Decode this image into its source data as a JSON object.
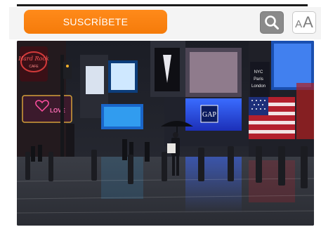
{
  "toolbar": {
    "subscribe_label": "SUSCRÍBETE",
    "search_icon": "magnifier",
    "font_size_icon": {
      "small_letter": "A",
      "big_letter": "A"
    }
  },
  "photo": {
    "signs": {
      "hard_rock_line1": "Hard Rock",
      "hard_rock_line2": "CAFE",
      "gap": "GAP",
      "love_sign": "LOVE",
      "nyc_line1": "NYC",
      "nyc_line2": "Paris",
      "nyc_line3": "London"
    }
  },
  "colors": {
    "accent": "#f58220",
    "toolbar_bg": "#f4f4f4"
  }
}
